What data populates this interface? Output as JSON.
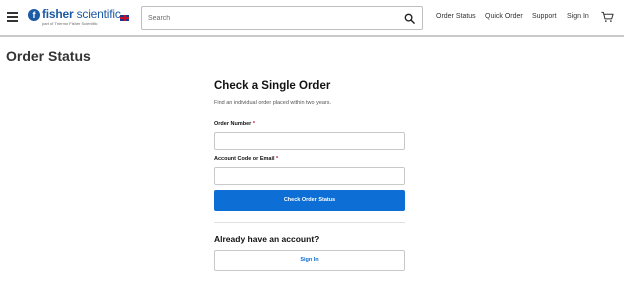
{
  "header": {
    "logo": {
      "name_bold": "fisher",
      "name_light": " scientific",
      "tagline": "part of Thermo Fisher Scientific",
      "mark": "f",
      "color": "#1b5aa5"
    },
    "search": {
      "placeholder": "Search"
    },
    "nav": [
      "Order Status",
      "Quick Order",
      "Support",
      "Sign In"
    ],
    "icons": [
      "hamburger-menu-icon",
      "uk-flag-icon",
      "search-icon",
      "cart-icon"
    ]
  },
  "page": {
    "title": "Order Status"
  },
  "form": {
    "title": "Check a Single Order",
    "subtitle": "Find an individual order placed within two years.",
    "order_number_label": "Order Number",
    "account_label": "Account Code or Email",
    "required_marker": "*",
    "submit_label": "Check Order Status",
    "account_heading": "Already have an account?",
    "sign_in_label": "Sign In"
  },
  "colors": {
    "primary": "#0d6ed5",
    "required": "#c8102e"
  }
}
